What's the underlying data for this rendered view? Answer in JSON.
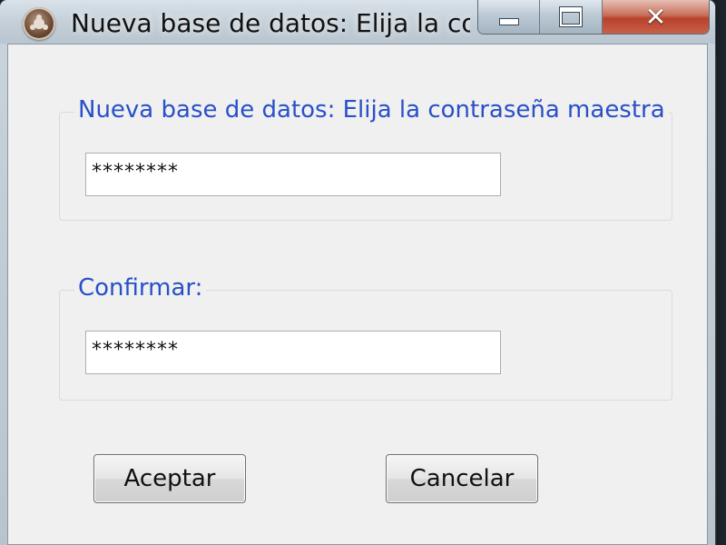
{
  "window": {
    "title": "Nueva base de datos: Elija la co...",
    "icon": "keepass-app-icon",
    "caption": {
      "minimize_icon": "minimize-icon",
      "maximize_icon": "maximize-icon",
      "close_icon": "close-icon",
      "close_glyph": "✕"
    }
  },
  "dialog": {
    "master_password": {
      "legend": "Nueva base de datos: Elija la contraseña maestra",
      "value": "********"
    },
    "confirm": {
      "legend": "Confirmar:",
      "value": "********"
    },
    "buttons": {
      "ok_label": "Aceptar",
      "cancel_label": "Cancelar"
    }
  },
  "colors": {
    "legend_text": "#2850c8",
    "close_button": "#c8604a",
    "client_background": "#f0f0f0"
  }
}
